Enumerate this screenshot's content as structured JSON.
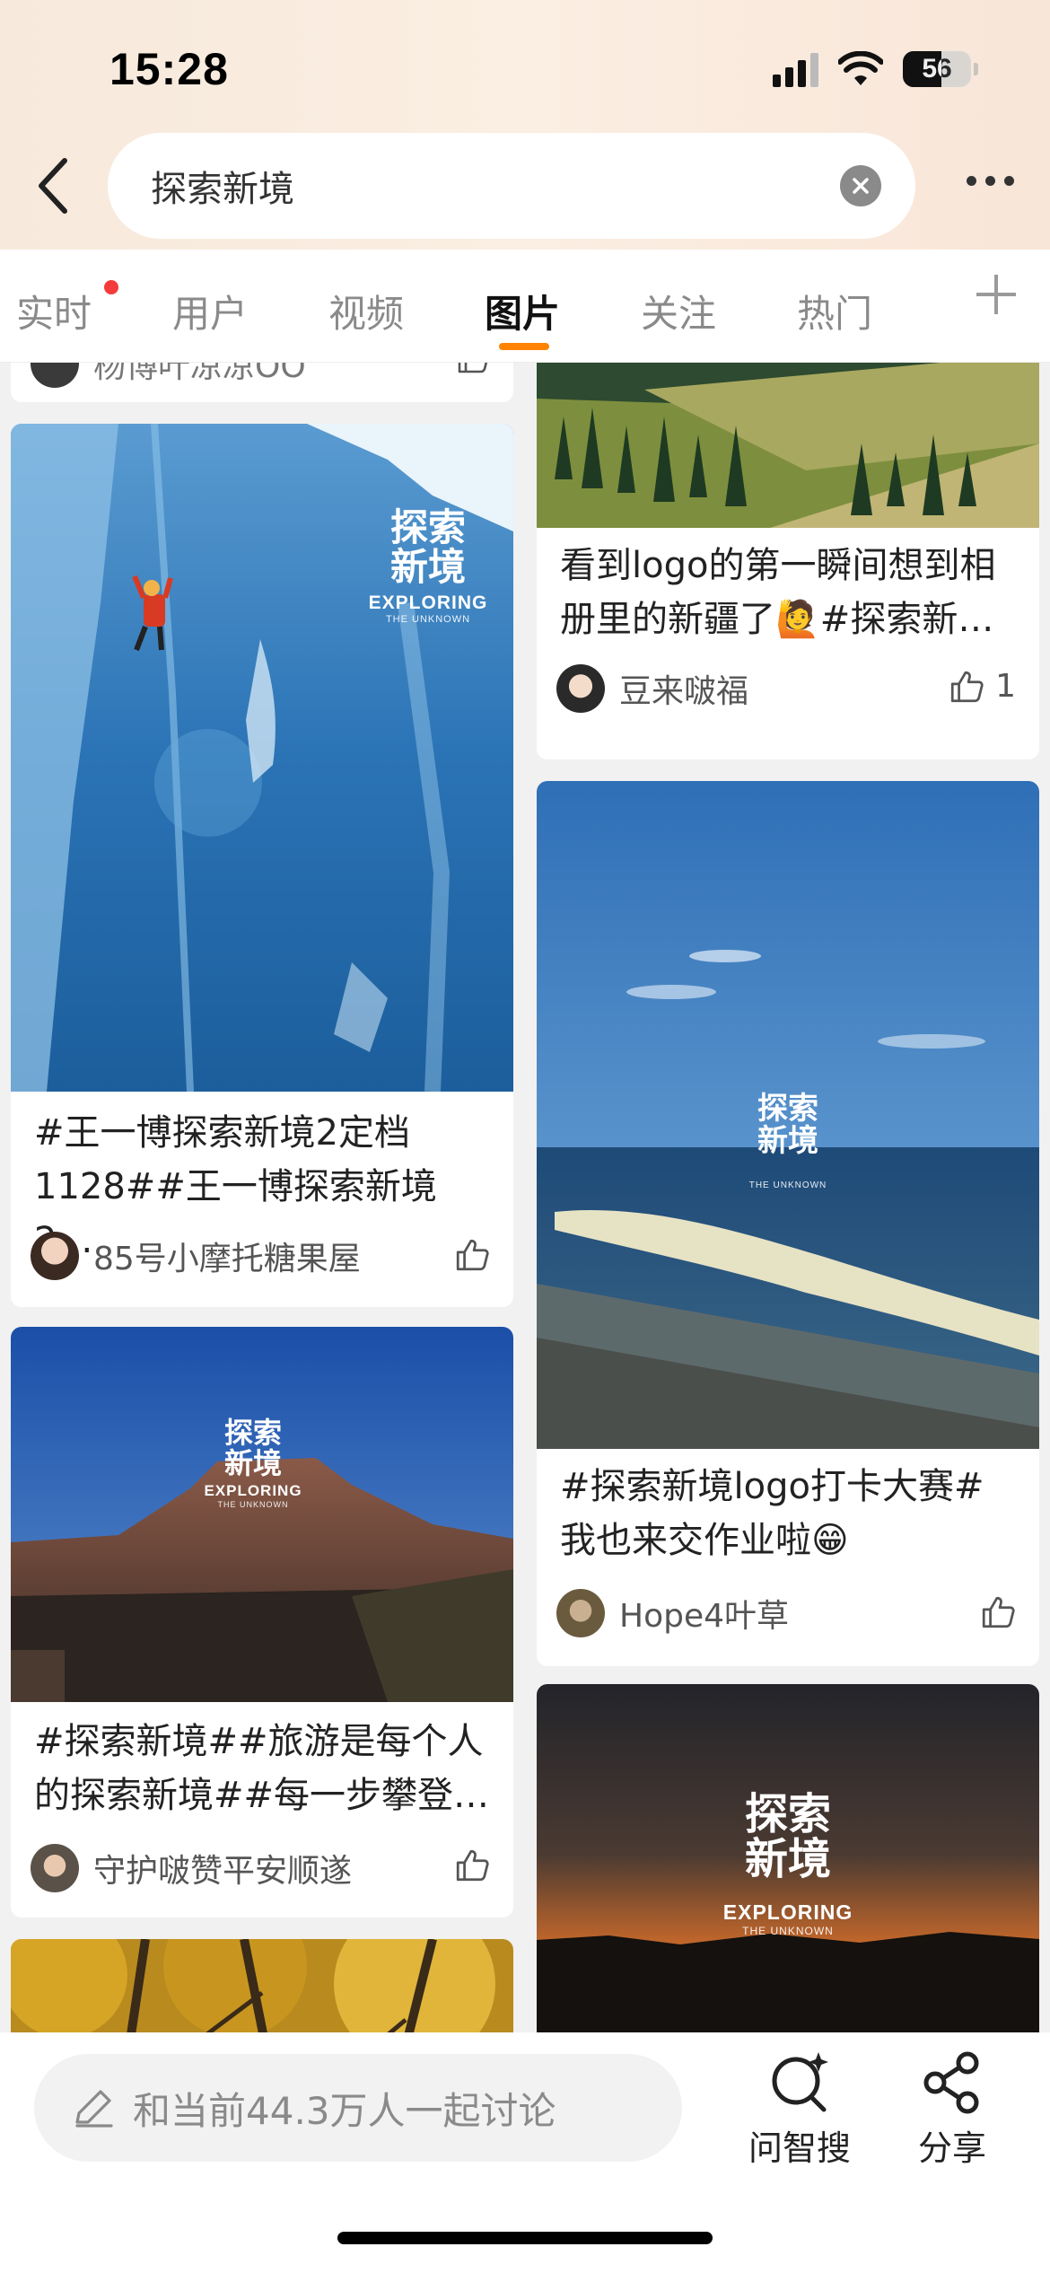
{
  "status_bar": {
    "time": "15:28",
    "battery": "56"
  },
  "search": {
    "query": "探索新境"
  },
  "tabs": [
    {
      "label": "实时",
      "has_dot": true
    },
    {
      "label": "用户"
    },
    {
      "label": "视频"
    },
    {
      "label": "图片",
      "active": true
    },
    {
      "label": "关注"
    },
    {
      "label": "热门"
    }
  ],
  "feed": {
    "left": [
      {
        "title": "",
        "author": "杨博叶凉凉OO",
        "likes": ""
      },
      {
        "title_line1": "#王一博探索新境2定档",
        "title_line2": "1128##王一博探索新境2…",
        "author": "85号小摩托糖果屋",
        "likes": "",
        "overlay": {
          "cn_line1": "探索",
          "cn_line2": "新境",
          "en": "EXPLORING",
          "sub": "THE UNKNOWN"
        }
      },
      {
        "title_line1": "#探索新境##旅游是每个人",
        "title_line2": "的探索新境##每一步攀登…",
        "author": "守护啵赞平安顺遂",
        "likes": "",
        "overlay": {
          "cn_line1": "探索",
          "cn_line2": "新境",
          "en": "EXPLORING",
          "sub": "THE UNKNOWN"
        }
      }
    ],
    "right": [
      {
        "title_line1": "看到logo的第一瞬间想到相",
        "title_line2": "册里的新疆了🙋#探索新…",
        "author": "豆来啵福",
        "likes": "1"
      },
      {
        "title_line1": "#探索新境logo打卡大赛#",
        "title_line2": "我也来交作业啦😁",
        "author": "Hope4叶草",
        "likes": "",
        "overlay": {
          "cn_line1": "探索",
          "cn_line2": "新境",
          "sub": "THE UNKNOWN"
        }
      },
      {
        "overlay": {
          "cn_line1": "探索",
          "cn_line2": "新境",
          "en": "EXPLORING",
          "sub": "THE UNKNOWN"
        }
      }
    ]
  },
  "bottom_bar": {
    "comment_placeholder": "和当前44.3万人一起讨论",
    "ask_label": "问智搜",
    "share_label": "分享"
  },
  "colors": {
    "accent": "#ff8200",
    "notify_dot": "#f43b3b"
  }
}
